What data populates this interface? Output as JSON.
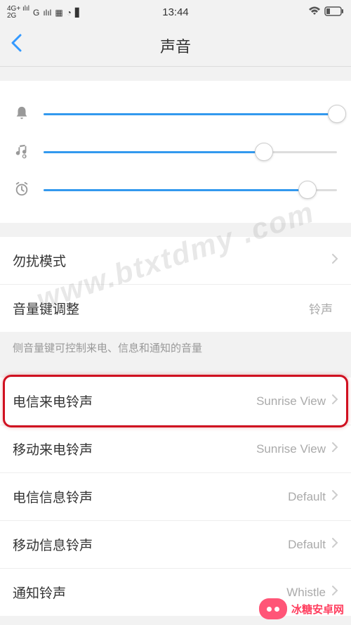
{
  "status": {
    "net1": "4G+",
    "net2": "2G",
    "sig1": "ılıl",
    "net3": "G",
    "sig2": "ılıl",
    "time": "13:44"
  },
  "nav": {
    "title": "声音"
  },
  "sliders": {
    "ringtone_pct": 100,
    "media_pct": 75,
    "alarm_pct": 90
  },
  "section1": {
    "dnd_label": "勿扰模式",
    "volkey_label": "音量键调整",
    "volkey_value": "铃声",
    "note": "侧音量键可控制来电、信息和通知的音量"
  },
  "section2": {
    "items": [
      {
        "label": "电信来电铃声",
        "value": "Sunrise View",
        "hl": true
      },
      {
        "label": "移动来电铃声",
        "value": "Sunrise View",
        "hl": false
      },
      {
        "label": "电信信息铃声",
        "value": "Default",
        "hl": false
      },
      {
        "label": "移动信息铃声",
        "value": "Default",
        "hl": false
      },
      {
        "label": "通知铃声",
        "value": "Whistle",
        "hl": false
      }
    ]
  },
  "watermark": "www.btxtdmy .com",
  "badge": "冰糖安卓网"
}
